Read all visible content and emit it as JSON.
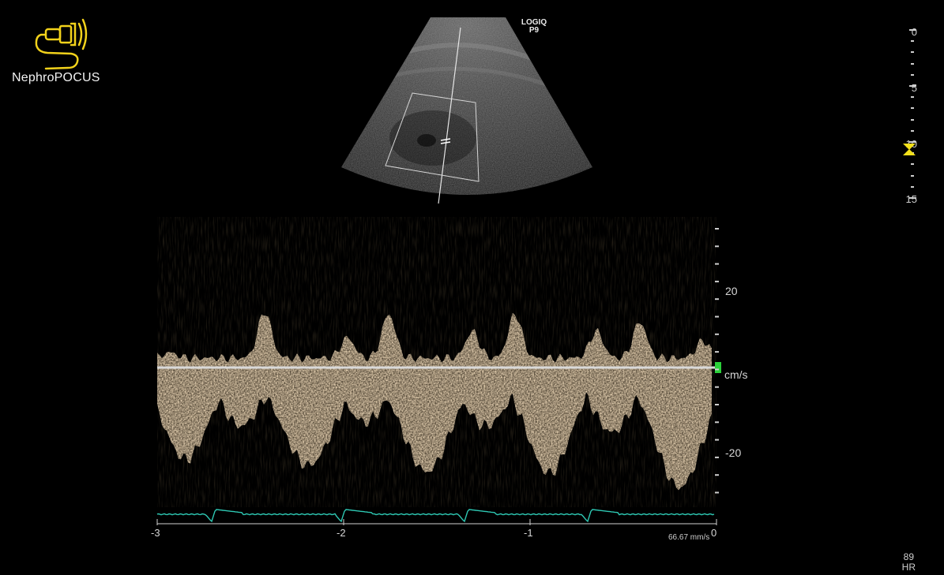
{
  "brand": {
    "name": "NephroPOCUS",
    "logo_icon": "ultrasound-probe-icon",
    "color": "#f2d21b"
  },
  "scanner": {
    "model_line1": "LOGIQ",
    "model_line2": "P9"
  },
  "depth_scale": {
    "labels": [
      "0",
      "5",
      "10",
      "15"
    ],
    "focus_icon": "focus-hourglass-icon",
    "focus_color": "#f2e01a"
  },
  "doppler": {
    "velocity_labels": [
      "20",
      "cm/s",
      "-20"
    ],
    "time_labels": [
      "-3",
      "-2",
      "-1",
      "0"
    ],
    "sweep_speed": "66.67 mm/s",
    "baseline_marker_color": "#2bd13a",
    "spectrum_color": "#e8c89a",
    "ecg_color": "#2ec9b4"
  },
  "heart_rate": {
    "value": "89",
    "unit": "HR"
  }
}
